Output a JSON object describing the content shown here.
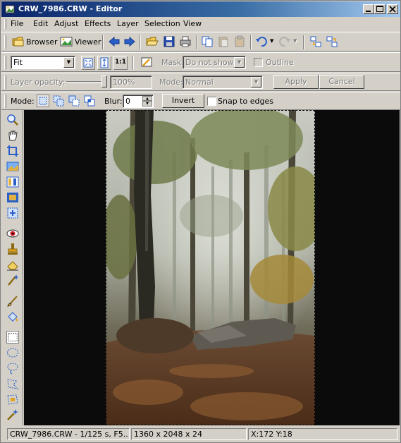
{
  "window": {
    "title": "CRW_7986.CRW - Editor"
  },
  "menu": [
    "File",
    "Edit",
    "Adjust",
    "Effects",
    "Layer",
    "Selection",
    "View"
  ],
  "toolbar1": {
    "browser_label": "Browser",
    "viewer_label": "Viewer"
  },
  "toolbar2": {
    "zoom_value": "Fit",
    "zoom_1to1": "1:1",
    "mask_label": "Mask:",
    "mask_value": "Do not show",
    "outline_label": "Outline"
  },
  "toolbar3": {
    "opacity_label": "Layer opacity:",
    "opacity_value": "100%",
    "mode_label": "Mode:",
    "mode_value": "Normal",
    "apply_label": "Apply",
    "cancel_label": "Cancel"
  },
  "toolbar4": {
    "mode_label": "Mode:",
    "blur_label": "Blur:",
    "blur_value": "0",
    "invert_label": "Invert",
    "snap_label": "Snap to edges"
  },
  "status": {
    "file_info": "CRW_7986.CRW - 1/125 s, F5....",
    "dimensions": "1360 x 2048 x 24",
    "coords": "X:172  Y:18"
  },
  "colors": {
    "title_start": "#0a246a",
    "title_end": "#a6caf0",
    "canvas_bg": "#0b0b0b",
    "face": "#d4d0c8"
  }
}
